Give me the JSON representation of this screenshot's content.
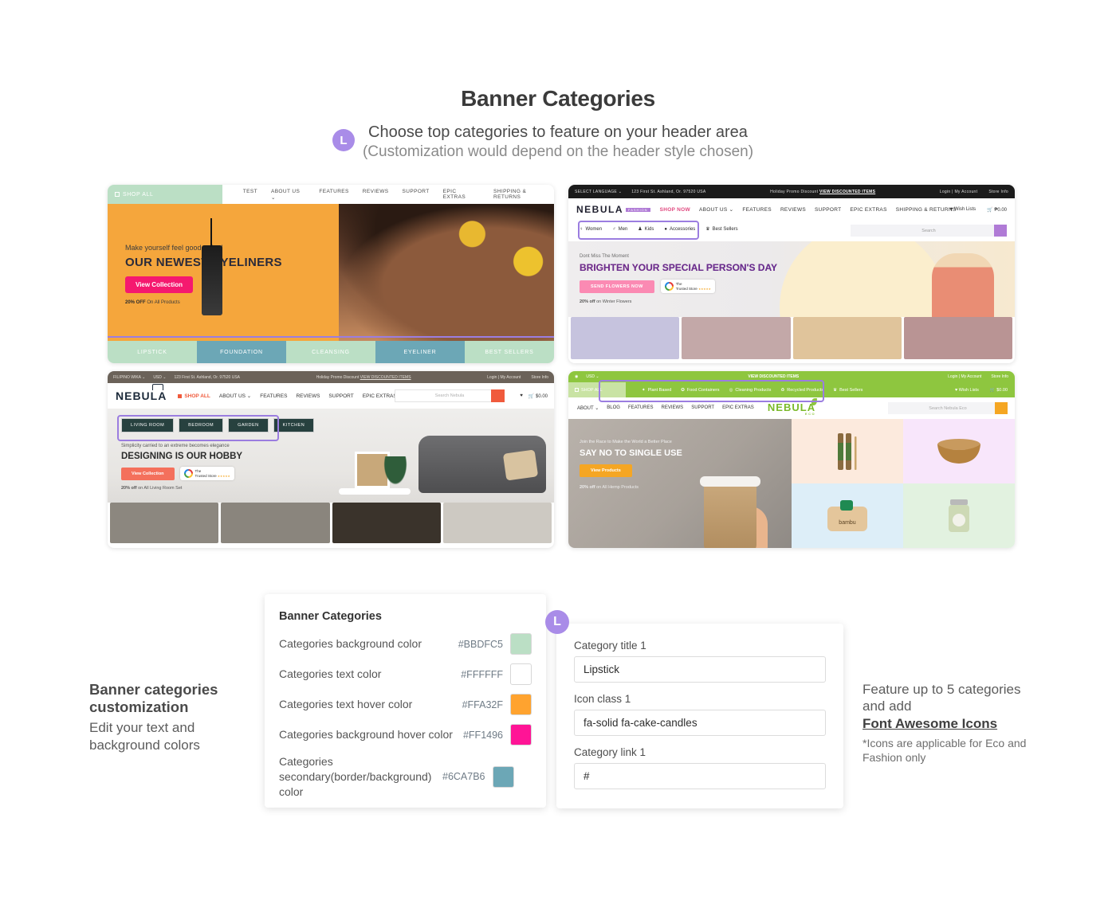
{
  "header": {
    "title": "Banner Categories",
    "badge": "L",
    "subtitle_line1": "Choose top categories to feature on your header area",
    "subtitle_line2": "(Customization would depend on the header style chosen)"
  },
  "banner1": {
    "shop_all": "SHOP ALL",
    "nav": [
      "TEST",
      "ABOUT US ⌄",
      "FEATURES",
      "REVIEWS",
      "SUPPORT",
      "EPIC EXTRAS",
      "SHIPPING & RETURNS"
    ],
    "kicker": "Make yourself feel good today!",
    "headline": "OUR NEWEST EYELINERS",
    "button": "View Collection",
    "promo_bold": "20% OFF",
    "promo_rest": " On All Products",
    "categories": [
      {
        "label": "LIPSTICK",
        "bg": "#bbdfc5"
      },
      {
        "label": "FOUNDATION",
        "bg": "#6ca7b6"
      },
      {
        "label": "CLEANSING",
        "bg": "#bbdfc5"
      },
      {
        "label": "EYELINER",
        "bg": "#6ca7b6"
      },
      {
        "label": "BEST SELLERS",
        "bg": "#bbdfc5"
      }
    ]
  },
  "banner2": {
    "topbar_left": "SELECT LANGUAGE ⌄",
    "topbar_address": "123 First St. Ashland, Or. 97520 USA",
    "topbar_promo": "Holiday Promo Discount ",
    "topbar_promo_link": "VIEW DISCOUNTED ITEMS",
    "topbar_right": [
      "Login | My Account",
      "Store Info"
    ],
    "logo": "NEBULA",
    "logo_sub": "FASHION",
    "nav": [
      "SHOP NOW",
      "ABOUT US ⌄",
      "FEATURES",
      "REVIEWS",
      "SUPPORT",
      "EPIC EXTRAS",
      "SHIPPING & RETURNS"
    ],
    "wishlist": "Wish Lists",
    "cart": "₱0.00",
    "chips": [
      "Women",
      "Men",
      "Kids",
      "Accessories",
      "Best Sellers"
    ],
    "search_placeholder": "Search",
    "kicker": "Dont Miss The Moment",
    "headline": "BRIGHTEN YOUR SPECIAL PERSON'S DAY",
    "button": "SEND FLOWERS NOW",
    "trusted_small": "The",
    "trusted_title": "Trusted Store",
    "promo_bold": "20% off",
    "promo_rest": " on Winter Flowers",
    "tiles": [
      "#c6c3de",
      "#c3a8a8",
      "#e0c49b",
      "#b99494"
    ]
  },
  "banner3": {
    "topbar_left": "FILIPINO WIKA ⌄",
    "topbar_currency": "USD ⌄",
    "topbar_address": "123 First St. Ashland, Or. 97520 USA",
    "topbar_promo": "Holiday Promo Discount ",
    "topbar_promo_link": "VIEW DISCOUNTED ITEMS",
    "topbar_right": [
      "Login | My Account",
      "Store Info"
    ],
    "logo": "NEBULA",
    "nav": [
      "SHOP ALL",
      "ABOUT US ⌄",
      "FEATURES",
      "REVIEWS",
      "SUPPORT",
      "EPIC EXTRAS"
    ],
    "search_placeholder": "Search Nebula",
    "cart": "$0.00",
    "chips": [
      "LIVING ROOM",
      "BEDROOM",
      "GARDEN",
      "KITCHEN"
    ],
    "kicker": "Simplicity carried to an extreme becomes elegance",
    "headline": "DESIGNING IS OUR HOBBY",
    "button": "View Collection",
    "trusted_small": "The",
    "trusted_title": "Trusted Store",
    "promo_bold": "20% off",
    "promo_rest": " on All Living Room Set",
    "tiles": [
      "#8c877f",
      "#8a857d",
      "#3a332b",
      "#cdc9c2"
    ]
  },
  "banner4": {
    "topbar_currency": "USD ⌄",
    "topbar_promo_link": "VIEW DISCOUNTED ITEMS",
    "topbar_right": [
      "Login | My Account",
      "Store Info"
    ],
    "shop_all": "SHOP ALL",
    "chips": [
      "Plant Based",
      "Food Containers",
      "Cleaning Products",
      "Recycled Products",
      "Best Sellers"
    ],
    "wishlist": "Wish Lists",
    "cart": "$0.00",
    "nav": [
      "ABOUT ⌄",
      "BLOG",
      "FEATURES",
      "REVIEWS",
      "SUPPORT",
      "EPIC EXTRAS"
    ],
    "logo": "NEBULA",
    "logo_sub": "ECO",
    "search_placeholder": "Search Nebula Eco",
    "kicker": "Join the Race to Make the World a Better Place",
    "headline": "SAY NO TO SINGLE USE",
    "button": "View Products",
    "promo_bold": "20% off",
    "promo_rest": " on All Hemp Products",
    "tiles": [
      "#fceadd",
      "#f8e6fb",
      "#ddeef8",
      "#e2f2e0"
    ]
  },
  "colors_panel": {
    "title": "Banner Categories",
    "rows": [
      {
        "label": "Categories background color",
        "hex": "#BBDFC5",
        "swatch": "#bbdfc5"
      },
      {
        "label": "Categories text color",
        "hex": "#FFFFFF",
        "swatch": "#ffffff"
      },
      {
        "label": "Categories text hover color",
        "hex": "#FFA32F",
        "swatch": "#ffa32f"
      },
      {
        "label": "Categories background hover color",
        "hex": "#FF1496",
        "swatch": "#ff1496"
      },
      {
        "label": "Categories secondary(border/background) color",
        "hex": "#6CA7B6",
        "swatch": "#6ca7b6"
      }
    ]
  },
  "form_panel": {
    "badge": "L",
    "fields": [
      {
        "label": "Category title 1",
        "value": "Lipstick"
      },
      {
        "label": "Icon class 1",
        "value": "fa-solid fa-cake-candles"
      },
      {
        "label": "Category link 1",
        "value": "#"
      }
    ]
  },
  "note_left": {
    "heading": "Banner categories customization",
    "body": "Edit your text and background colors"
  },
  "note_right": {
    "line1": "Feature up to 5 categories and add",
    "line2": "Font Awesome Icons",
    "line3": "*Icons are applicable for Eco and Fashion only"
  }
}
